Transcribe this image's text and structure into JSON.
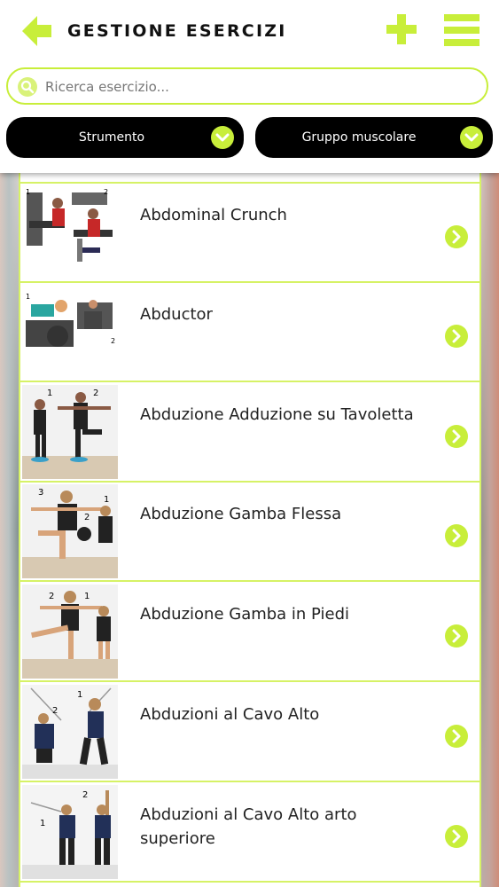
{
  "header": {
    "title": "GESTIONE ESERCIZI",
    "icons": {
      "back": "arrow-left-icon",
      "add": "plus-icon",
      "menu": "hamburger-menu-icon"
    }
  },
  "search": {
    "placeholder": "Ricerca esercizio...",
    "value": ""
  },
  "filters": [
    {
      "label": "Strumento"
    },
    {
      "label": "Gruppo muscolare"
    }
  ],
  "exercises": [
    {
      "name": "Abdominal Crunch"
    },
    {
      "name": "Abductor"
    },
    {
      "name": "Abduzione Adduzione su Tavoletta"
    },
    {
      "name": "Abduzione Gamba Flessa"
    },
    {
      "name": "Abduzione Gamba in Piedi"
    },
    {
      "name": "Abduzioni al Cavo Alto"
    },
    {
      "name": "Abduzioni al Cavo Alto arto superiore"
    }
  ],
  "colors": {
    "accent": "#c8ee3a",
    "accent_dark": "#b9e02b",
    "filter_bg": "#000000",
    "text": "#222222"
  }
}
